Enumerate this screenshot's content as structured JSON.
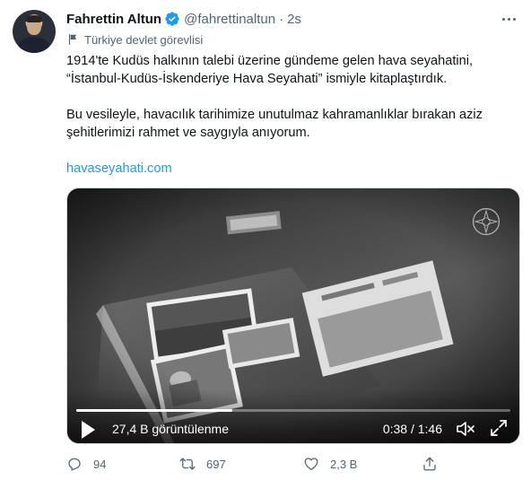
{
  "tweet": {
    "author_name": "Fahrettin Altun",
    "handle": "@fahrettinaltun",
    "separator": "·",
    "time": "2s",
    "label": "Türkiye devlet görevlisi",
    "text_line1": "1914'te Kudüs halkının talebi üzerine gündeme gelen hava seyahatini,",
    "text_line2": "“İstanbul-Kudüs-İskenderiye Hava Seyahati” ismiyle kitaplaştırdık.",
    "text_line3": "Bu vesileyle, havacılık tarihimize unutulmaz kahramanlıklar bırakan aziz",
    "text_line4": "şehitlerimizi rahmet ve saygıyla anıyorum.",
    "link": "havaseyahati.com"
  },
  "video": {
    "views": "27,4 B görüntülenme",
    "duration": "0:38 / 1:46",
    "progress": 0.36
  },
  "actions": {
    "replies": "94",
    "retweets": "697",
    "likes": "2,3 B"
  },
  "colors": {
    "accent": "#1d9bf0",
    "secondary_text": "#536471"
  }
}
